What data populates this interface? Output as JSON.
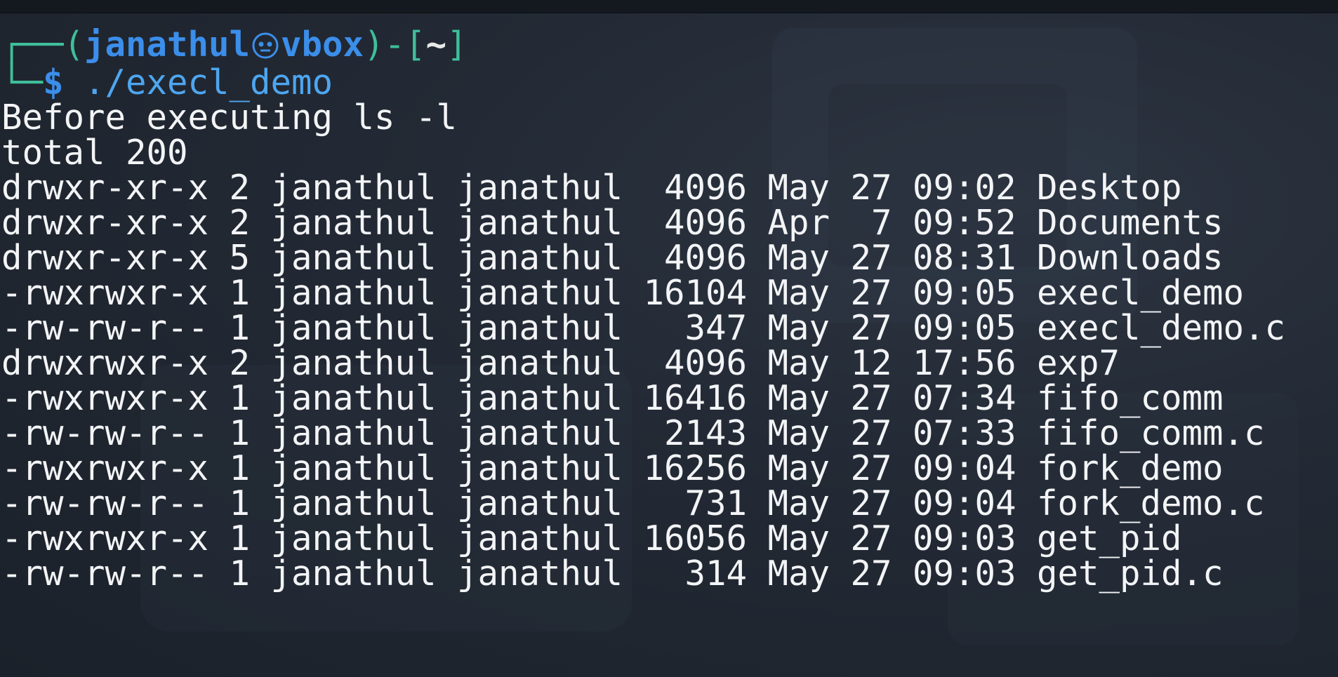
{
  "prompt": {
    "corner_top": "┌──(",
    "user": "janathul",
    "host": "vbox",
    "close_user": ")-[",
    "dir": "~",
    "close_dir": "]",
    "corner_bottom": "└─",
    "dollar": "$",
    "command": " ./execl_demo"
  },
  "output": {
    "message": "Before executing ls -l",
    "total": "total 200",
    "listing": [
      "drwxr-xr-x 2 janathul janathul  4096 May 27 09:02 Desktop",
      "drwxr-xr-x 2 janathul janathul  4096 Apr  7 09:52 Documents",
      "drwxr-xr-x 5 janathul janathul  4096 May 27 08:31 Downloads",
      "-rwxrwxr-x 1 janathul janathul 16104 May 27 09:05 execl_demo",
      "-rw-rw-r-- 1 janathul janathul   347 May 27 09:05 execl_demo.c",
      "drwxrwxr-x 2 janathul janathul  4096 May 12 17:56 exp7",
      "-rwxrwxr-x 1 janathul janathul 16416 May 27 07:34 fifo_comm",
      "-rw-rw-r-- 1 janathul janathul  2143 May 27 07:33 fifo_comm.c",
      "-rwxrwxr-x 1 janathul janathul 16256 May 27 09:04 fork_demo",
      "-rw-rw-r-- 1 janathul janathul   731 May 27 09:04 fork_demo.c",
      "-rwxrwxr-x 1 janathul janathul 16056 May 27 09:03 get_pid",
      "-rw-rw-r-- 1 janathul janathul   314 May 27 09:03 get_pid.c"
    ]
  },
  "colors": {
    "frame": "#3fbf9a",
    "user": "#3b8eea",
    "text": "#f3f4f6",
    "background": "#1f2631"
  },
  "icons": {
    "separator": "kali-skull-icon"
  }
}
